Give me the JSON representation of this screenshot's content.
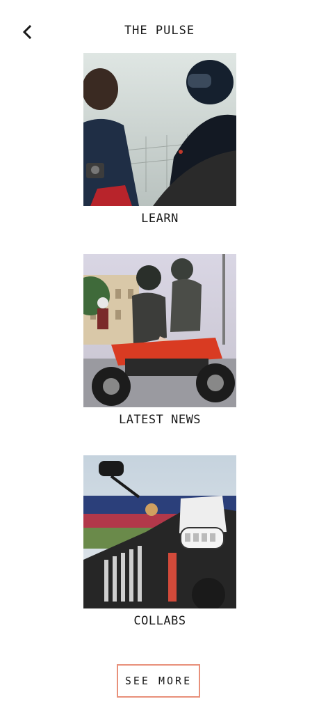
{
  "header": {
    "back_icon": "chevron-left-icon",
    "title": "THE PULSE"
  },
  "cards": [
    {
      "label": "LEARN",
      "image": "two-riders-talking-photo"
    },
    {
      "label": "LATEST NEWS",
      "image": "couple-riding-red-motorcycle-photo"
    },
    {
      "label": "COLLABS",
      "image": "electric-motorcycle-closeup-photo"
    }
  ],
  "actions": {
    "see_more_label": "SEE MORE"
  },
  "colors": {
    "accent_border": "#e8907a",
    "text": "#1a1a1a",
    "background": "#ffffff"
  }
}
